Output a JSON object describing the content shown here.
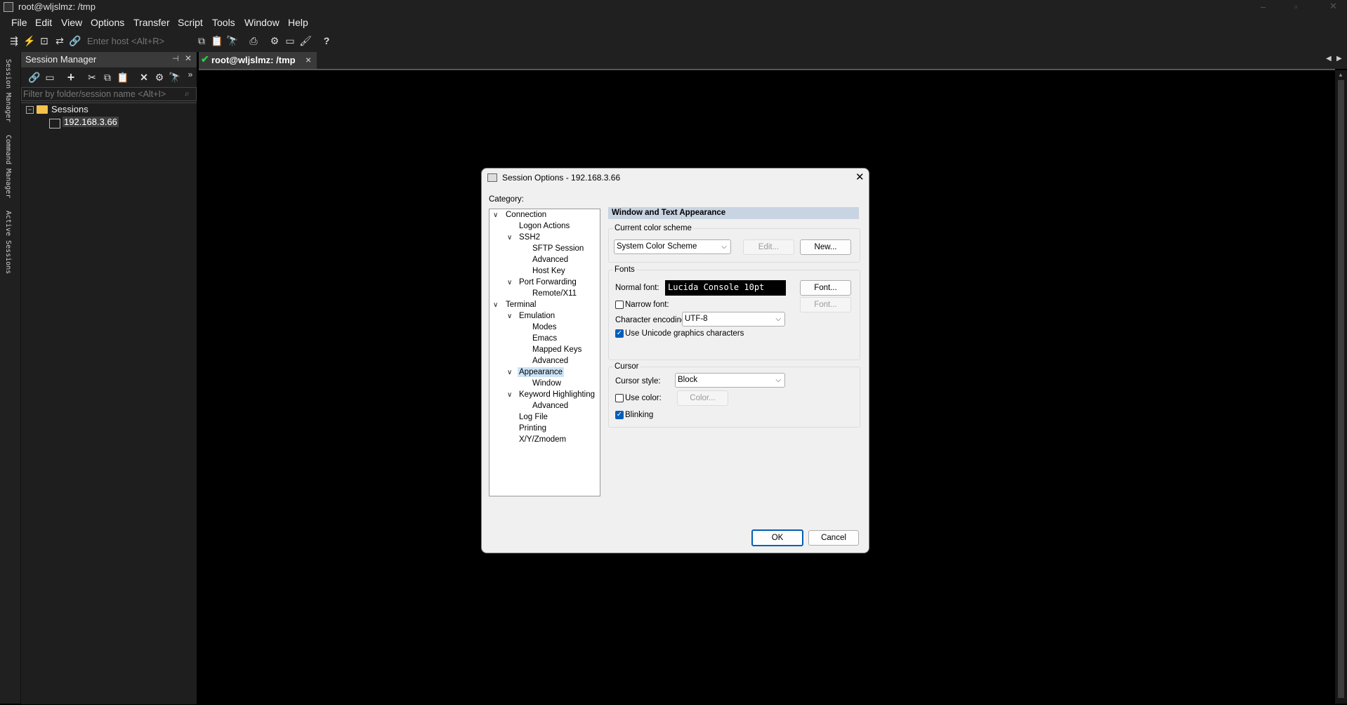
{
  "window": {
    "title": "root@wljslmz: /tmp"
  },
  "menu": [
    "File",
    "Edit",
    "View",
    "Options",
    "Transfer",
    "Script",
    "Tools",
    "Window",
    "Help"
  ],
  "toolbar": {
    "host_placeholder": "Enter host <Alt+R>"
  },
  "side_tabs": [
    "Session Manager",
    "Command Manager",
    "Active Sessions"
  ],
  "session_manager": {
    "title": "Session Manager",
    "filter_placeholder": "Filter by folder/session name <Alt+I>",
    "folder": "Sessions",
    "session": "192.168.3.66"
  },
  "tab": {
    "label": "root@wljslmz: /tmp",
    "close": "×"
  },
  "dialog": {
    "title": "Session Options - 192.168.3.66",
    "category_label": "Category:",
    "categories": {
      "connection": "Connection",
      "logon_actions": "Logon Actions",
      "ssh2": "SSH2",
      "sftp_session": "SFTP Session",
      "advanced1": "Advanced",
      "host_key": "Host Key",
      "port_forwarding": "Port Forwarding",
      "remote_x11": "Remote/X11",
      "terminal": "Terminal",
      "emulation": "Emulation",
      "modes": "Modes",
      "emacs": "Emacs",
      "mapped_keys": "Mapped Keys",
      "advanced2": "Advanced",
      "appearance": "Appearance",
      "window": "Window",
      "keyword_highlighting": "Keyword Highlighting",
      "advanced3": "Advanced",
      "log_file": "Log File",
      "printing": "Printing",
      "xyzmodem": "X/Y/Zmodem"
    },
    "panel_title": "Window and Text Appearance",
    "color_scheme_label": "Current color scheme",
    "color_scheme_value": "System Color Scheme",
    "edit_button": "Edit...",
    "new_button": "New...",
    "fonts_label": "Fonts",
    "normal_font_label": "Normal font:",
    "normal_font_value": "Lucida Console 10pt",
    "font_button": "Font...",
    "narrow_font_label": "Narrow font:",
    "narrow_font_checked": false,
    "font_button2": "Font...",
    "encoding_label": "Character encoding:",
    "encoding_value": "UTF-8",
    "unicode_label": "Use Unicode graphics characters",
    "unicode_checked": true,
    "cursor_label": "Cursor",
    "cursor_style_label": "Cursor style:",
    "cursor_style_value": "Block",
    "use_color_label": "Use color:",
    "use_color_checked": false,
    "color_button": "Color...",
    "blinking_label": "Blinking",
    "blinking_checked": true,
    "ok_button": "OK",
    "cancel_button": "Cancel"
  },
  "colors": {
    "chrome": "#202020",
    "terminal_bg": "#000000",
    "accent": "#005fb8",
    "dialog_bg": "#f0f0f0"
  }
}
